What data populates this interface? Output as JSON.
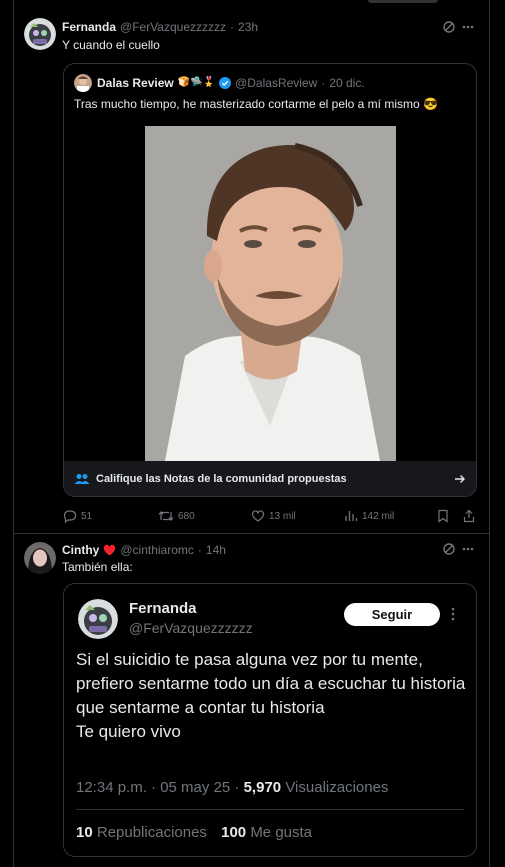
{
  "tweet1": {
    "name": "Fernanda",
    "handle": "@FerVazquezzzzzz",
    "time": "23h",
    "text": "Y cuando el cuello",
    "quote": {
      "name": "Dalas Review",
      "handle": "@DalasReview",
      "date": "20 dic.",
      "text": "Tras mucho tiempo, he masterizado cortarme el pelo a mí mismo",
      "notes_label": "Califique las Notas de la comunidad propuestas"
    },
    "actions": {
      "replies": "51",
      "retweets": "680",
      "likes": "13 mil",
      "views": "142 mil"
    }
  },
  "tweet2": {
    "name": "Cinthy",
    "handle": "@cinthiaromc",
    "time": "14h",
    "text": "También ella:",
    "card": {
      "name": "Fernanda",
      "handle": "@FerVazquezzzzzz",
      "follow_label": "Seguir",
      "text": "Si el suicidio te pasa alguna vez por tu mente, prefiero sentarme todo un día a escuchar tu historia que sentarme a contar tu historia\nTe quiero vivo",
      "time": "12:34 p.m. · 05 may 25 ·",
      "views_count": "5,970",
      "views_label": "Visualizaciones",
      "reposts_count": "10",
      "reposts_label": "Republicaciones",
      "likes_count": "100",
      "likes_label": "Me gusta"
    }
  },
  "colors": {
    "background": "#000000",
    "text": "#e7e9ea",
    "muted": "#71767b",
    "border": "#2f3336",
    "verified": "#1d9bf0",
    "heart": "#f91880"
  }
}
